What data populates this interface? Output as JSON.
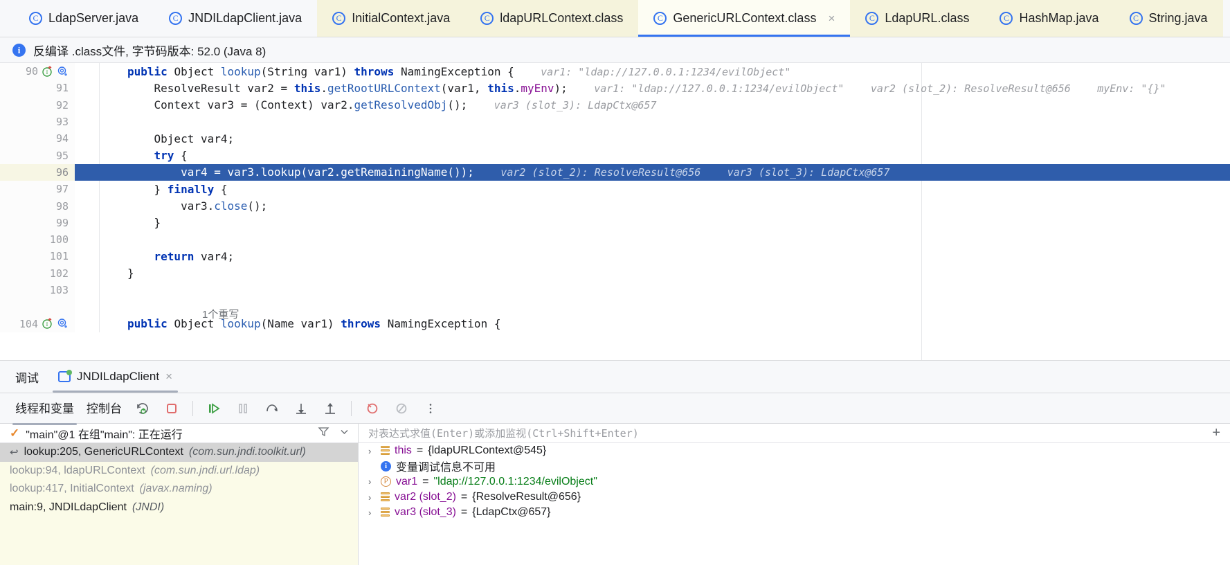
{
  "tabs": [
    {
      "label": "LdapServer.java",
      "icon": "class-icon",
      "state": "plain"
    },
    {
      "label": "JNDILdapClient.java",
      "icon": "class-icon",
      "state": "plain"
    },
    {
      "label": "InitialContext.java",
      "icon": "class-icon",
      "state": "group"
    },
    {
      "label": "ldapURLContext.class",
      "icon": "class-icon",
      "state": "group"
    },
    {
      "label": "GenericURLContext.class",
      "icon": "class-icon",
      "state": "active",
      "close": "×"
    },
    {
      "label": "LdapURL.class",
      "icon": "class-icon",
      "state": "group"
    },
    {
      "label": "HashMap.java",
      "icon": "class-icon",
      "state": "group"
    },
    {
      "label": "String.java",
      "icon": "class-icon",
      "state": "group"
    }
  ],
  "tabbar": {
    "overflow_icon": "›"
  },
  "notice": {
    "icon": "info-icon",
    "text": "反编译 .class文件, 字节码版本: 52.0 (Java 8)"
  },
  "editor": {
    "fold_note": "1个重写",
    "lines": [
      {
        "num": "90",
        "gutter_icons": [
          "override-impl-icon",
          "usage-search-icon"
        ],
        "indent": 0,
        "tokens": [
          {
            "t": "public ",
            "c": "kw"
          },
          {
            "t": "Object ",
            "c": "typ"
          },
          {
            "t": "lookup",
            "c": "mth"
          },
          {
            "t": "(String var1) ",
            "c": "pln"
          },
          {
            "t": "throws ",
            "c": "kw"
          },
          {
            "t": "NamingException {",
            "c": "pln"
          }
        ],
        "hints": [
          "var1: \"ldap://127.0.0.1:1234/evilObject\""
        ]
      },
      {
        "num": "91",
        "gutter_icons": [],
        "indent": 1,
        "tokens": [
          {
            "t": "ResolveResult var2 = ",
            "c": "pln"
          },
          {
            "t": "this",
            "c": "kw"
          },
          {
            "t": ".",
            "c": "pln"
          },
          {
            "t": "getRootURLContext",
            "c": "mth"
          },
          {
            "t": "(var1, ",
            "c": "pln"
          },
          {
            "t": "this",
            "c": "kw"
          },
          {
            "t": ".",
            "c": "pln"
          },
          {
            "t": "myEnv",
            "c": "fld"
          },
          {
            "t": ");",
            "c": "pln"
          }
        ],
        "hints": [
          "var1: \"ldap://127.0.0.1:1234/evilObject\"",
          "var2 (slot_2): ResolveResult@656",
          "myEnv: \"{}\""
        ]
      },
      {
        "num": "92",
        "gutter_icons": [],
        "indent": 1,
        "tokens": [
          {
            "t": "Context var3 = (Context) var2.",
            "c": "pln"
          },
          {
            "t": "getResolvedObj",
            "c": "mth"
          },
          {
            "t": "();",
            "c": "pln"
          }
        ],
        "hints": [
          "var3 (slot_3): LdapCtx@657"
        ]
      },
      {
        "num": "93",
        "gutter_icons": [],
        "indent": 0,
        "tokens": [],
        "hints": []
      },
      {
        "num": "94",
        "gutter_icons": [],
        "indent": 1,
        "tokens": [
          {
            "t": "Object var4;",
            "c": "pln"
          }
        ],
        "hints": []
      },
      {
        "num": "95",
        "gutter_icons": [],
        "indent": 1,
        "tokens": [
          {
            "t": "try",
            "c": "kw"
          },
          {
            "t": " {",
            "c": "pln"
          }
        ],
        "hints": []
      },
      {
        "num": "96",
        "gutter_icons": [],
        "indent": 2,
        "current": true,
        "tokens": [
          {
            "t": "var4 = var3.",
            "c": "pln"
          },
          {
            "t": "lookup",
            "c": "mth"
          },
          {
            "t": "(var2.",
            "c": "pln"
          },
          {
            "t": "getRemainingName",
            "c": "mth"
          },
          {
            "t": "());",
            "c": "pln"
          }
        ],
        "hints": [
          "var2 (slot_2): ResolveResult@656",
          "var3 (slot_3): LdapCtx@657"
        ]
      },
      {
        "num": "97",
        "gutter_icons": [],
        "indent": 1,
        "tokens": [
          {
            "t": "} ",
            "c": "pln"
          },
          {
            "t": "finally",
            "c": "kw"
          },
          {
            "t": " {",
            "c": "pln"
          }
        ],
        "hints": []
      },
      {
        "num": "98",
        "gutter_icons": [],
        "indent": 2,
        "tokens": [
          {
            "t": "var3.",
            "c": "pln"
          },
          {
            "t": "close",
            "c": "mth"
          },
          {
            "t": "();",
            "c": "pln"
          }
        ],
        "hints": []
      },
      {
        "num": "99",
        "gutter_icons": [],
        "indent": 1,
        "tokens": [
          {
            "t": "}",
            "c": "pln"
          }
        ],
        "hints": []
      },
      {
        "num": "100",
        "gutter_icons": [],
        "indent": 0,
        "tokens": [],
        "hints": []
      },
      {
        "num": "101",
        "gutter_icons": [],
        "indent": 1,
        "tokens": [
          {
            "t": "return",
            "c": "kw"
          },
          {
            "t": " var4;",
            "c": "pln"
          }
        ],
        "hints": []
      },
      {
        "num": "102",
        "gutter_icons": [],
        "indent": 0,
        "tokens": [
          {
            "t": "}",
            "c": "pln"
          }
        ],
        "hints": []
      },
      {
        "num": "103",
        "gutter_icons": [],
        "indent": 0,
        "tokens": [],
        "hints": []
      },
      {
        "num": "",
        "gutter_icons": [],
        "indent": 0,
        "tokens": [],
        "hints": [],
        "foldnote": true
      },
      {
        "num": "104",
        "gutter_icons": [
          "override-impl-icon",
          "usage-search-icon"
        ],
        "indent": 0,
        "tokens": [
          {
            "t": "public ",
            "c": "kw"
          },
          {
            "t": "Object ",
            "c": "typ"
          },
          {
            "t": "lookup",
            "c": "mth"
          },
          {
            "t": "(Name var1) ",
            "c": "pln"
          },
          {
            "t": "throws ",
            "c": "kw"
          },
          {
            "t": "NamingException {",
            "c": "pln"
          }
        ],
        "hints": []
      }
    ]
  },
  "debug": {
    "panel_title": "调试",
    "run_config": "JNDILdapClient",
    "run_config_close": "×",
    "toolbar": {
      "tab_threads": "线程和变量",
      "tab_console": "控制台",
      "buttons": [
        "rerun-debug-icon",
        "stop-icon",
        "resume-icon",
        "pause-icon",
        "step-over-icon",
        "step-into-icon",
        "step-out-icon",
        "mute-breakpoints-icon",
        "disable-breakpoints-icon",
        "more-options-icon"
      ]
    },
    "thread": {
      "status_icon": "check-icon",
      "label": "\"main\"@1 在组\"main\": 正在运行",
      "filter_icon": "filter-icon",
      "dropdown_icon": "chevron-down-icon"
    },
    "frames": [
      {
        "text": "lookup:205, GenericURLContext",
        "pkg": "(com.sun.jndi.toolkit.url)",
        "selected": true,
        "dim": false,
        "icon": "return-arrow-icon"
      },
      {
        "text": "lookup:94, ldapURLContext",
        "pkg": "(com.sun.jndi.url.ldap)",
        "selected": false,
        "dim": true,
        "icon": ""
      },
      {
        "text": "lookup:417, InitialContext",
        "pkg": "(javax.naming)",
        "selected": false,
        "dim": true,
        "icon": ""
      },
      {
        "text": "main:9, JNDILdapClient",
        "pkg": "(JNDI)",
        "selected": false,
        "dim": false,
        "icon": ""
      }
    ],
    "watch": {
      "placeholder": "对表达式求值(Enter)或添加监视(Ctrl+Shift+Enter)",
      "add_icon": "+"
    },
    "variables": [
      {
        "chev": "›",
        "icon": "object-icon",
        "name": "this",
        "eq": " = ",
        "value": "{ldapURLContext@545}",
        "kind": "obj"
      },
      {
        "chev": "",
        "icon": "info-icon",
        "name": "",
        "eq": "",
        "value": "变量调试信息不可用",
        "kind": "note"
      },
      {
        "chev": "›",
        "icon": "param-icon",
        "name": "var1",
        "eq": " = ",
        "value": "\"ldap://127.0.0.1:1234/evilObject\"",
        "kind": "str"
      },
      {
        "chev": "›",
        "icon": "object-icon",
        "name": "var2 (slot_2)",
        "eq": " = ",
        "value": "{ResolveResult@656}",
        "kind": "obj"
      },
      {
        "chev": "›",
        "icon": "object-icon",
        "name": "var3 (slot_3)",
        "eq": " = ",
        "value": "{LdapCtx@657}",
        "kind": "obj"
      }
    ]
  },
  "colors": {
    "accent": "#3574f0",
    "current_line": "#2f5dab",
    "tab_group": "#f5f3dc",
    "frames_bg": "#fbfbe8",
    "keyword": "#0033b3",
    "method": "#2a5db0",
    "field": "#871094",
    "hint": "#9a9ca1",
    "string": "#067d17"
  }
}
